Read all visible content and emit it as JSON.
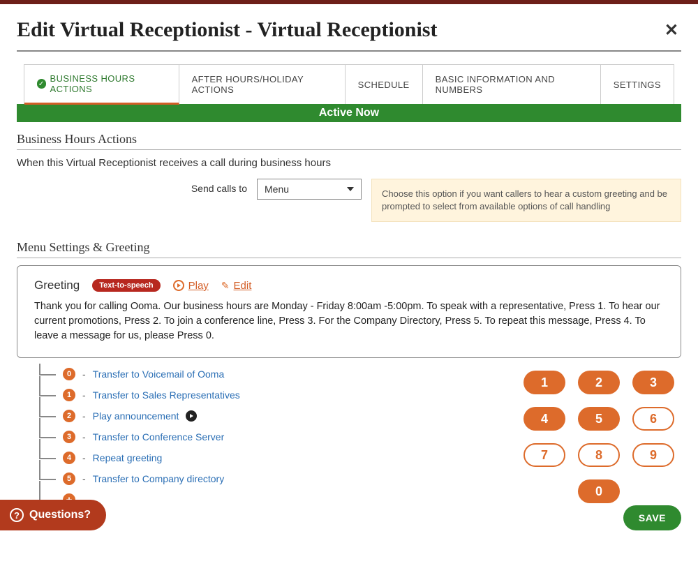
{
  "header": {
    "title": "Edit Virtual Receptionist - Virtual Receptionist"
  },
  "tabs": {
    "business_hours": "BUSINESS HOURS ACTIONS",
    "after_hours": "AFTER HOURS/HOLIDAY ACTIONS",
    "schedule": "SCHEDULE",
    "basic_info": "BASIC INFORMATION AND NUMBERS",
    "settings": "SETTINGS"
  },
  "active_banner": "Active Now",
  "section": {
    "title": "Business Hours Actions",
    "intro": "When this Virtual Receptionist receives a call during business hours",
    "send_calls_label": "Send calls to",
    "send_calls_value": "Menu",
    "help": "Choose this option if you want callers to hear a custom greeting and be prompted to select from available options of call handling"
  },
  "menu": {
    "title": "Menu Settings & Greeting",
    "greeting_label": "Greeting",
    "badge": "Text-to-speech",
    "play": "Play",
    "edit": "Edit",
    "greeting_text": "Thank you for calling Ooma. Our business hours are Monday - Friday 8:00am -5:00pm. To speak with a representative, Press 1. To hear our current promotions, Press 2. To join a conference line, Press 3. For the Company Directory, Press 5. To repeat this message, Press 4. To leave a message for us, please Press 0."
  },
  "tree": [
    {
      "digit": "0",
      "prefix": "Transfer to Voicemail of ",
      "target": "Ooma"
    },
    {
      "digit": "1",
      "prefix": "Transfer to ",
      "target": "Sales Representatives"
    },
    {
      "digit": "2",
      "prefix": "",
      "target": "Play announcement",
      "play": true
    },
    {
      "digit": "3",
      "prefix": "",
      "target": "Transfer to Conference Server"
    },
    {
      "digit": "4",
      "prefix": "",
      "target": "Repeat greeting"
    },
    {
      "digit": "5",
      "prefix": "",
      "target": "Transfer to Company directory"
    }
  ],
  "keypad": {
    "one": "1",
    "two": "2",
    "three": "3",
    "four": "4",
    "five": "5",
    "six": "6",
    "seven": "7",
    "eight": "8",
    "nine": "9",
    "zero": "0",
    "used": [
      "1",
      "2",
      "3",
      "4",
      "5",
      "0"
    ]
  },
  "footer": {
    "questions": "Questions?",
    "save": "SAVE"
  }
}
